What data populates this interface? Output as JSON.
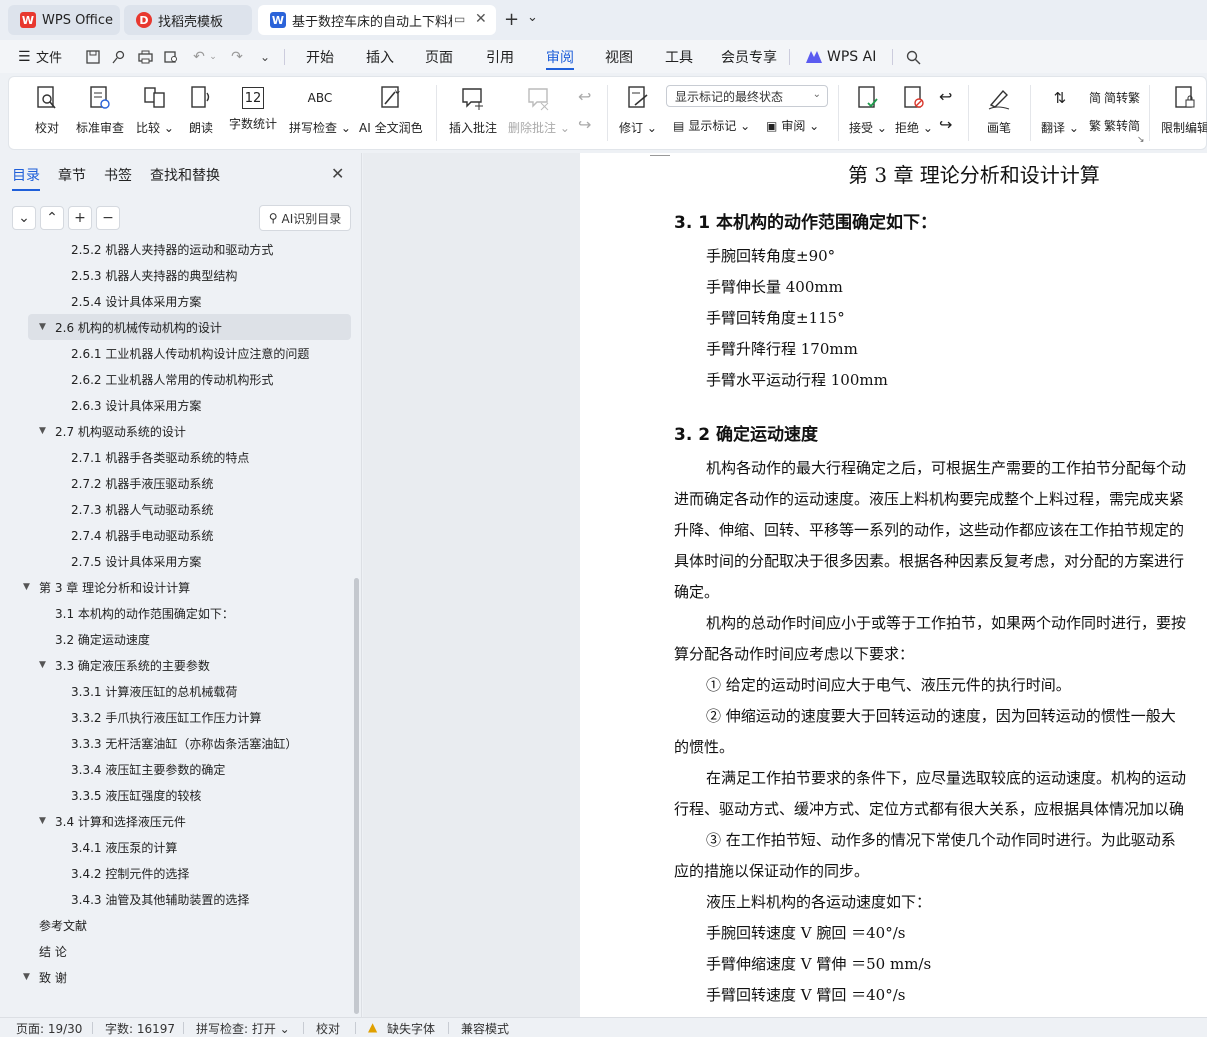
{
  "tabs": [
    {
      "label": "WPS Office",
      "logo": "W",
      "logo_color": "#e8382f"
    },
    {
      "label": "找稻壳模板",
      "logo": "D",
      "logo_color": "#e8382f"
    },
    {
      "label": "基于数控车床的自动上下料机",
      "logo": "W",
      "logo_color": "#2b63d9"
    }
  ],
  "titlebar": {
    "new_tab": "+",
    "tab_list": "⌄"
  },
  "menu": {
    "file": "文件",
    "items": [
      "开始",
      "插入",
      "页面",
      "引用",
      "审阅",
      "视图",
      "工具",
      "会员专享"
    ],
    "active": "审阅",
    "wps_ai": "WPS AI"
  },
  "ribbon": {
    "proofread": "校对",
    "standard_review": "标准审查",
    "compare": "比较",
    "read_aloud": "朗读",
    "word_count": "字数统计",
    "spell_check": "拼写检查",
    "ai_proof": "AI 全文润色",
    "insert_comment": "插入批注",
    "delete_comment": "删除批注",
    "revise": "修订",
    "markup_select": "显示标记的最终状态",
    "show_markup": "显示标记",
    "review_pane": "审阅",
    "accept": "接受",
    "reject": "拒绝",
    "pen": "画笔",
    "translate": "翻译",
    "to_traditional": "简转繁",
    "to_simplified": "繁转简",
    "restrict_edit": "限制编辑",
    "word_count_icon_text": "12",
    "spell_icon_text": "ABC"
  },
  "nav": {
    "tabs": [
      "目录",
      "章节",
      "书签",
      "查找和替换"
    ],
    "active_tab": "目录",
    "ai_toc": "AI识别目录",
    "toc": [
      {
        "text": "2.5.2 机器人夹持器的运动和驱动方式",
        "level": 3,
        "arrow": ""
      },
      {
        "text": "2.5.3  机器人夹持器的典型结构",
        "level": 3,
        "arrow": ""
      },
      {
        "text": "2.5.4 设计具体采用方案",
        "level": 3,
        "arrow": ""
      },
      {
        "text": "2.6 机构的机械传动机构的设计",
        "level": 2,
        "arrow": "▼",
        "selected": true
      },
      {
        "text": "2.6.1 工业机器人传动机构设计应注意的问题",
        "level": 3,
        "arrow": ""
      },
      {
        "text": "2.6.2 工业机器人常用的传动机构形式",
        "level": 3,
        "arrow": ""
      },
      {
        "text": "2.6.3  设计具体采用方案",
        "level": 3,
        "arrow": ""
      },
      {
        "text": "2.7 机构驱动系统的设计",
        "level": 2,
        "arrow": "▼"
      },
      {
        "text": "2.7.1 机器手各类驱动系统的特点",
        "level": 3,
        "arrow": ""
      },
      {
        "text": "2.7.2 机器手液压驱动系统",
        "level": 3,
        "arrow": ""
      },
      {
        "text": "2.7.3  机器人气动驱动系统",
        "level": 3,
        "arrow": ""
      },
      {
        "text": "2.7.4 机器手电动驱动系统",
        "level": 3,
        "arrow": ""
      },
      {
        "text": "2.7.5 设计具体采用方案",
        "level": 3,
        "arrow": ""
      },
      {
        "text": "第 3 章    理论分析和设计计算",
        "level": 1,
        "arrow": "▼"
      },
      {
        "text": "3.1 本机构的动作范围确定如下：",
        "level": 2,
        "arrow": ""
      },
      {
        "text": "3.2  确定运动速度",
        "level": 2,
        "arrow": ""
      },
      {
        "text": "3.3 确定液压系统的主要参数",
        "level": 2,
        "arrow": "▼"
      },
      {
        "text": "3.3.1 计算液压缸的总机械载荷",
        "level": 3,
        "arrow": ""
      },
      {
        "text": "3.3.2 手爪执行液压缸工作压力计算",
        "level": 3,
        "arrow": ""
      },
      {
        "text": "3.3.3  无杆活塞油缸（亦称齿条活塞油缸）",
        "level": 3,
        "arrow": ""
      },
      {
        "text": "3.3.4 液压缸主要参数的确定",
        "level": 3,
        "arrow": ""
      },
      {
        "text": "3.3.5 液压缸强度的较核",
        "level": 3,
        "arrow": ""
      },
      {
        "text": "3.4 计算和选择液压元件",
        "level": 2,
        "arrow": "▼"
      },
      {
        "text": "3.4.1 液压泵的计算",
        "level": 3,
        "arrow": ""
      },
      {
        "text": "3.4.2 控制元件的选择",
        "level": 3,
        "arrow": ""
      },
      {
        "text": "3.4.3 油管及其他辅助装置的选择",
        "level": 3,
        "arrow": ""
      },
      {
        "text": "参考文献",
        "level": 1,
        "arrow": ""
      },
      {
        "text": "结    论",
        "level": 1,
        "arrow": ""
      },
      {
        "text": "致      谢",
        "level": 1,
        "arrow": "▼"
      }
    ]
  },
  "document": {
    "chapter_title": "第 3 章    理论分析和设计计算",
    "sec1_title": "3. 1 本机构的动作范围确定如下：",
    "sec1_lines": [
      "手腕回转角度±90°",
      "手臂伸长量  400mm",
      "手臂回转角度±115°",
      "手臂升降行程  170mm",
      "手臂水平运动行程  100mm"
    ],
    "sec2_title": "3. 2  确定运动速度",
    "paragraphs": [
      "    机构各动作的最大行程确定之后，可根据生产需要的工作拍节分配每个动",
      "进而确定各动作的运动速度。液压上料机构要完成整个上料过程，需完成夹紧",
      "升降、伸缩、回转、平移等一系列的动作，这些动作都应该在工作拍节规定的",
      "具体时间的分配取决于很多因素。根据各种因素反复考虑，对分配的方案进行",
      "确定。",
      "    机构的总动作时间应小于或等于工作拍节，如果两个动作同时进行，要按",
      "算分配各动作时间应考虑以下要求：",
      "    ①  给定的运动时间应大于电气、液压元件的执行时间。",
      "    ②  伸缩运动的速度要大于回转运动的速度，因为回转运动的惯性一般大",
      "的惯性。",
      "    在满足工作拍节要求的条件下，应尽量选取较底的运动速度。机构的运动",
      "行程、驱动方式、缓冲方式、定位方式都有很大关系，应根据具体情况加以确",
      "    ③  在工作拍节短、动作多的情况下常使几个动作同时进行。为此驱动系",
      "应的措施以保证动作的同步。",
      "    液压上料机构的各运动速度如下：",
      "    手腕回转速度  V 腕回  ＝40°/s",
      "    手臂伸缩速度  V 臂伸  ＝50 mm/s",
      "    手臂回转速度  V 臂回  ＝40°/s"
    ]
  },
  "status": {
    "page": "页面: 19/30",
    "words": "字数: 16197",
    "spell": "拼写检查: 打开",
    "proof": "校对",
    "missing_font": "缺失字体",
    "compat": "兼容模式"
  }
}
